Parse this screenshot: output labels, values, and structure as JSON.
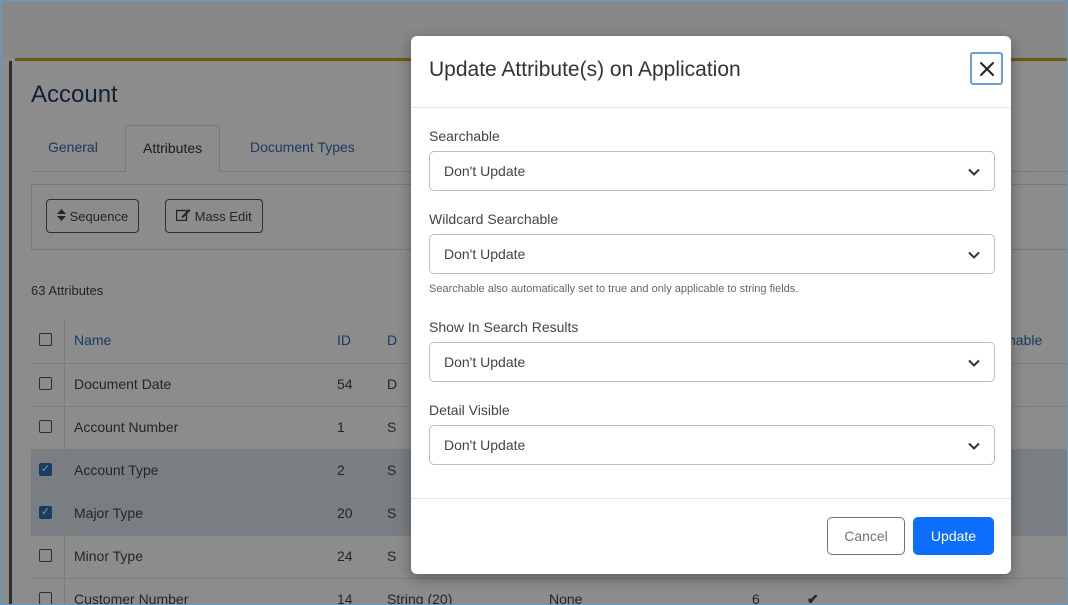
{
  "background": {
    "page_title": "Account",
    "tabs": [
      {
        "label": "General"
      },
      {
        "label": "Attributes"
      },
      {
        "label": "Document Types"
      }
    ],
    "toolbar": {
      "sequence_label": "Sequence",
      "mass_edit_label": "Mass Edit"
    },
    "count_label": "63 Attributes",
    "table": {
      "headers": {
        "name": "Name",
        "id": "ID",
        "col3": "D",
        "searchable": "chable"
      },
      "rows": [
        {
          "name": "Document Date",
          "id": "54",
          "col3": "D",
          "col4": "",
          "col5": "",
          "check": "",
          "selected": false
        },
        {
          "name": "Account Number",
          "id": "1",
          "col3": "S",
          "col4": "",
          "col5": "",
          "check": "",
          "selected": false
        },
        {
          "name": "Account Type",
          "id": "2",
          "col3": "S",
          "col4": "",
          "col5": "",
          "check": "",
          "selected": true
        },
        {
          "name": "Major Type",
          "id": "20",
          "col3": "S",
          "col4": "",
          "col5": "",
          "check": "",
          "selected": true
        },
        {
          "name": "Minor Type",
          "id": "24",
          "col3": "S",
          "col4": "",
          "col5": "",
          "check": "",
          "selected": false
        },
        {
          "name": "Customer Number",
          "id": "14",
          "col3": "String (20)",
          "col4": "None",
          "col5": "6",
          "check": "✔",
          "selected": false
        }
      ]
    }
  },
  "modal": {
    "title": "Update Attribute(s) on Application",
    "fields": [
      {
        "label": "Searchable",
        "value": "Don't Update"
      },
      {
        "label": "Wildcard Searchable",
        "value": "Don't Update"
      },
      {
        "label": "Show In Search Results",
        "value": "Don't Update"
      },
      {
        "label": "Detail Visible",
        "value": "Don't Update"
      }
    ],
    "help_text": "Searchable also automatically set to true and only applicable to string fields.",
    "cancel_label": "Cancel",
    "update_label": "Update"
  },
  "colors": {
    "primary": "#0d6efd",
    "link": "#2f6db3",
    "accent_line": "#c9a227"
  },
  "icons": {
    "sequence": "sort-icon",
    "mass_edit": "edit-icon",
    "close": "close-icon",
    "select": "chevron-down-icon",
    "row_check": "checkmark-icon"
  }
}
